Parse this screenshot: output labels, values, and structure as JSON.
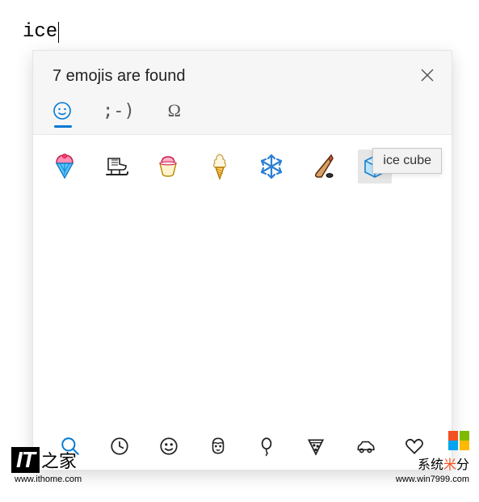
{
  "search": {
    "query": "ice"
  },
  "panel": {
    "results_label": "7 emojis are found",
    "tabs": [
      {
        "id": "emoji",
        "label_icon": "smile-icon",
        "active": true
      },
      {
        "id": "kaomoji",
        "label": ";-)",
        "active": false
      },
      {
        "id": "symbols",
        "label": "Ω",
        "active": false
      }
    ],
    "tooltip": "ice cube",
    "emojis": [
      {
        "name": "shaved-ice"
      },
      {
        "name": "ice-skate"
      },
      {
        "name": "ice-cream"
      },
      {
        "name": "soft-ice-cream"
      },
      {
        "name": "snowflake"
      },
      {
        "name": "ice-hockey"
      },
      {
        "name": "ice-cube",
        "hover": true
      }
    ],
    "categories": [
      {
        "name": "search",
        "active": true
      },
      {
        "name": "recent"
      },
      {
        "name": "smileys"
      },
      {
        "name": "people"
      },
      {
        "name": "celebration"
      },
      {
        "name": "food"
      },
      {
        "name": "transport"
      },
      {
        "name": "heart"
      }
    ]
  },
  "watermarks": {
    "left": {
      "brand_it": "IT",
      "brand_zhi": "之家",
      "url": "www.ithome.com"
    },
    "right": {
      "brand_part1": "系统",
      "brand_mid": "米",
      "brand_part2": "分",
      "url": "www.win7999.com"
    }
  }
}
